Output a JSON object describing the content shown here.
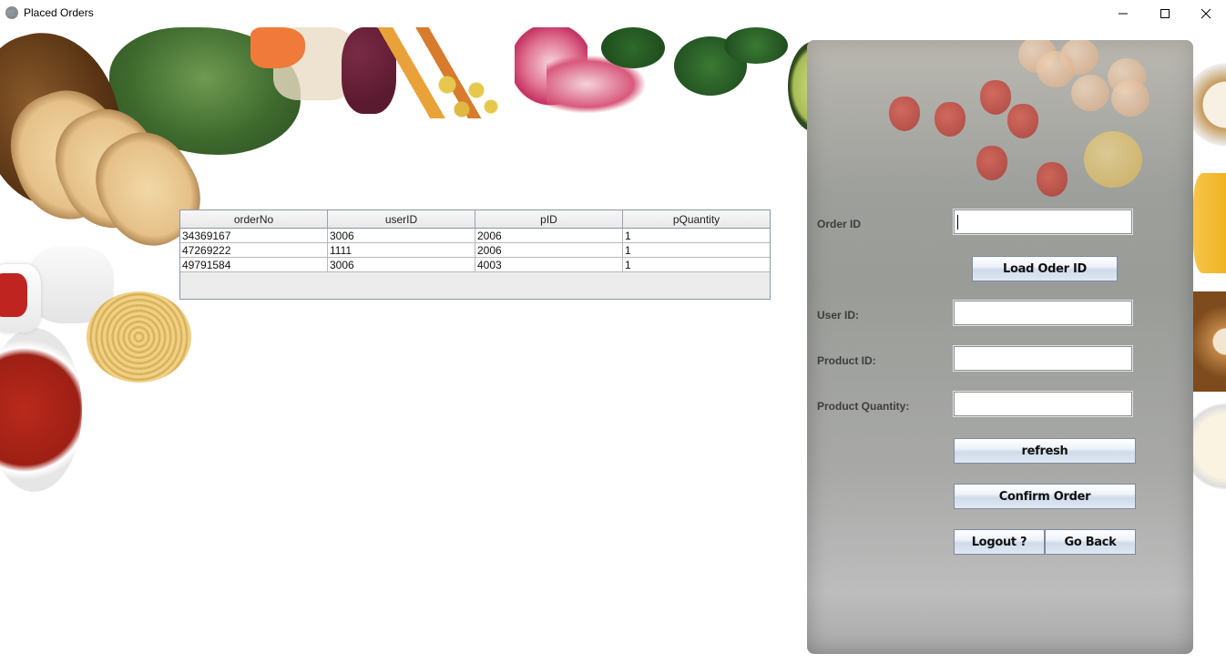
{
  "window": {
    "title": "Placed Orders",
    "app_icon": "shopping-cart-icon"
  },
  "table": {
    "columns": [
      "orderNo",
      "userID",
      "pID",
      "pQuantity"
    ],
    "rows": [
      [
        "34369167",
        "3006",
        "2006",
        "1"
      ],
      [
        "47269222",
        "1111",
        "2006",
        "1"
      ],
      [
        "49791584",
        "3006",
        "4003",
        "1"
      ]
    ]
  },
  "form": {
    "order_id_label": "Order ID",
    "order_id_value": "",
    "load_button": "Load Oder ID",
    "user_id_label": "User ID:",
    "user_id_value": "",
    "product_id_label": "Product ID:",
    "product_id_value": "",
    "product_qty_label": "Product Quantity:",
    "product_qty_value": "",
    "refresh_button": "refresh",
    "confirm_button": "Confirm Order",
    "logout_button": "Logout ?",
    "back_button": "Go Back"
  }
}
